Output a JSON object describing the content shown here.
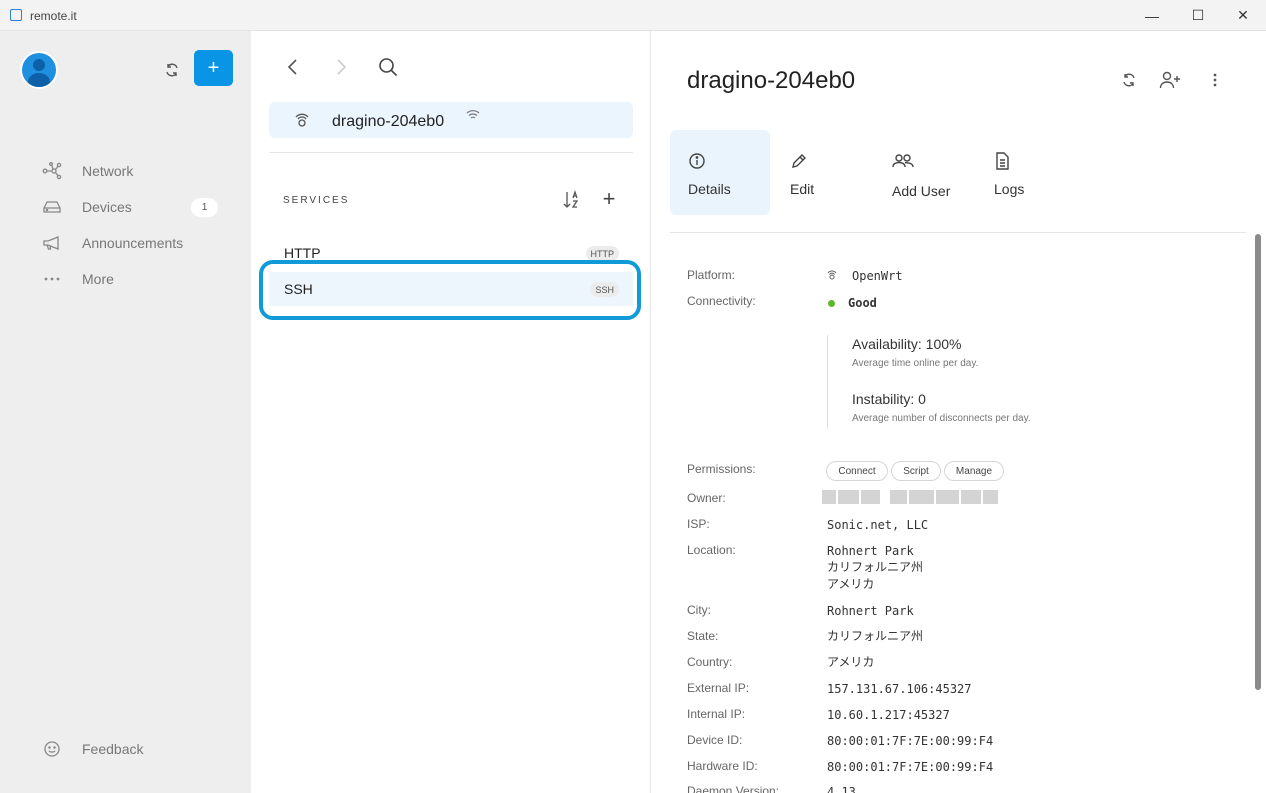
{
  "window": {
    "title": "remote.it",
    "minimize": "—",
    "maximize": "☐",
    "close": "✕"
  },
  "sidebar": {
    "add_label": "+",
    "nav": [
      {
        "label": "Network",
        "icon": "network-icon"
      },
      {
        "label": "Devices",
        "icon": "devices-icon",
        "badge": "1"
      },
      {
        "label": "Announcements",
        "icon": "megaphone-icon"
      },
      {
        "label": "More",
        "icon": "more-icon"
      }
    ],
    "feedback_label": "Feedback"
  },
  "middle": {
    "device_name": "dragino-204eb0",
    "services_heading": "SERVICES",
    "services": [
      {
        "name": "HTTP",
        "badge": "HTTP",
        "selected": false
      },
      {
        "name": "SSH",
        "badge": "SSH",
        "selected": true
      }
    ]
  },
  "details": {
    "title": "dragino-204eb0",
    "tabs": [
      {
        "label": "Details",
        "icon": "info-icon",
        "active": true
      },
      {
        "label": "Edit",
        "icon": "pencil-icon",
        "active": false
      },
      {
        "label": "Add User",
        "icon": "users-icon",
        "active": false
      },
      {
        "label": "Logs",
        "icon": "document-icon",
        "active": false
      }
    ],
    "labels": {
      "platform": "Platform:",
      "connectivity": "Connectivity:",
      "permissions": "Permissions:",
      "owner": "Owner:",
      "isp": "ISP:",
      "location": "Location:",
      "city": "City:",
      "state": "State:",
      "country": "Country:",
      "external_ip": "External IP:",
      "internal_ip": "Internal IP:",
      "device_id": "Device ID:",
      "hardware_id": "Hardware ID:",
      "daemon_version": "Daemon Version:"
    },
    "values": {
      "platform": "OpenWrt",
      "connectivity": "Good",
      "availability_title": "Availability: 100%",
      "availability_sub": "Average time online per day.",
      "instability_title": "Instability: 0",
      "instability_sub": "Average number of disconnects per day.",
      "permissions": [
        "Connect",
        "Script",
        "Manage"
      ],
      "isp": "Sonic.net, LLC",
      "location_city": "Rohnert Park",
      "location_state": "カリフォルニア州",
      "location_country": "アメリカ",
      "city": "Rohnert Park",
      "state": "カリフォルニア州",
      "country": "アメリカ",
      "external_ip": "157.131.67.106:45327",
      "internal_ip": "10.60.1.217:45327",
      "device_id": "80:00:01:7F:7E:00:99:F4",
      "hardware_id": "80:00:01:7F:7E:00:99:F4",
      "daemon_version": "4.13"
    }
  },
  "colors": {
    "accent": "#0a94e6",
    "highlight_ring": "#119ad8",
    "good": "#5bb829",
    "sidebar_bg": "#eeeeee",
    "selected_bg": "#edf6fd"
  }
}
